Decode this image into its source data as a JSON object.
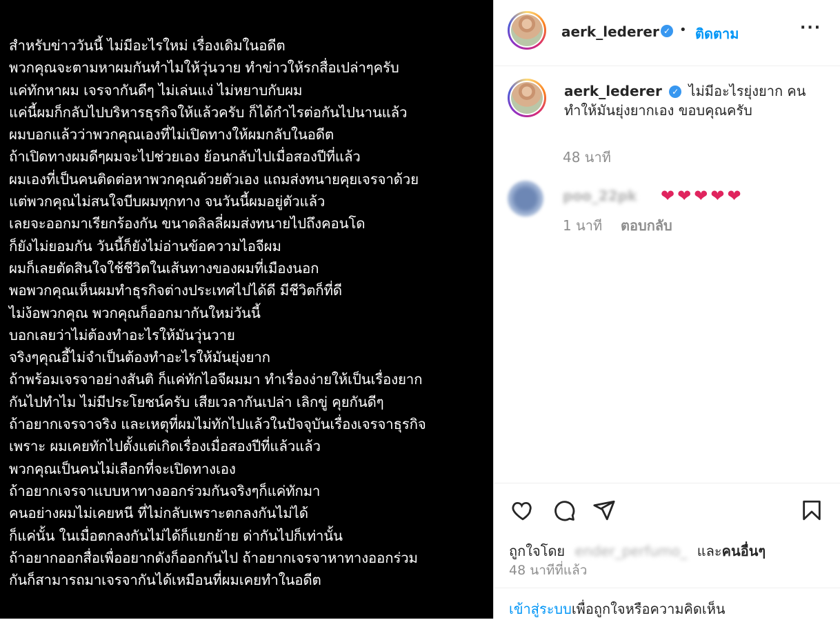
{
  "post": {
    "lines": [
      "สำหรับข่าววันนี้ ไม่มีอะไรใหม่ เรื่องเดิมในอดีต",
      "พวกคุณจะตามหาผมกันทำไมให้วุ่นวาย ทำข่าวให้รกสื่อเปล่าๆครับ",
      "แค่ทักหาผม เจรจากันดีๆ ไม่เล่นแง่ ไม่หยาบกับผม",
      "แค่นี้ผมก็กลับไปบริหารธุรกิจให้แล้วครับ ก็ได้กำไรต่อกันไปนานแล้ว",
      "ผมบอกแล้วว่าพวกคุณเองที่ไม่เปิดทางให้ผมกลับในอดีต",
      "ถ้าเปิดทางผมดีๆผมจะไปช่วยเอง ย้อนกลับไปเมื่อสองปีที่แล้ว",
      "ผมเองที่เป็นคนติดต่อหาพวกคุณด้วยตัวเอง แถมส่งทนายคุยเจรจาด้วย",
      "แต่พวกคุณไม่สนใจบีบผมทุกทาง จนวันนี้ผมอยู่ตัวแล้ว",
      "เลยจะออกมาเรียกร้องกัน ขนาดลิลลี่ผมส่งทนายไปถึงคอนโด",
      "ก็ยังไม่ยอมกัน วันนี้ก็ยังไม่อ่านข้อความไอจีผม",
      "ผมก็เลยตัดสินใจใช้ชีวิตในเส้นทางของผมที่เมืองนอก",
      "พอพวกคุณเห็นผมทำธุรกิจต่างประเทศไปได้ดี มีชีวิตก็ที่ดี",
      "ไม่ง้อพวกคุณ พวกคุณก็ออกมากันใหม่วันนี้",
      "บอกเลยว่าไม่ต้องทำอะไรให้มันวุ่นวาย",
      "จริงๆคุณอี้ไม่จำเป็นต้องทำอะไรให้มันยุ่งยาก",
      "ถ้าพร้อมเจรจาอย่างสันติ ก็แค่ทักไอจีผมมา ทำเรื่องง่ายให้เป็นเรื่องยาก",
      "กันไปทำไม ไม่มีประโยชน์ครับ เสียเวลากันเปล่า เลิกขู่ คุยกันดีๆ",
      "ถ้าอยากเจรจาจริง และเหตุที่ผมไม่ทักไปแล้วในปัจจุบันเรื่องเจรจาธุรกิจ",
      "เพราะ ผมเคยทักไปตั้งแต่เกิดเรื่องเมื่อสองปีที่แล้วแล้ว",
      "พวกคุณเป็นคนไม่เลือกที่จะเปิดทางเอง",
      "ถ้าอยากเจรจาแบบหาทางออกร่วมกันจริงๆก็แค่ทักมา",
      "คนอย่างผมไม่เคยหนี ที่ไม่กลับเพราะตกลงกันไม่ได้",
      "ก็แค่นั้น ในเมื่อตกลงกันไม่ได้ก็แยกย้าย ด่ากันไปก็เท่านั้น",
      "ถ้าอยากออกสื่อเพื่ออยากดังก็ออกกันไป ถ้าอยากเจรจาหาทางออกร่วม",
      "กันก็สามารถมาเจรจากันได้เหมือนที่ผมเคยทำในอดีต"
    ]
  },
  "header": {
    "username": "aerk_lederer",
    "separator": "•",
    "follow_label": "ติดตาม",
    "more_label": "···"
  },
  "caption": {
    "username": "aerk_lederer",
    "text": "ไม่มีอะไรยุ่งยาก คนทำให้มันยุ่งยากเอง ขอบคุณครับ",
    "time": "48 นาที"
  },
  "comment": {
    "username_blurred": "poo_22pk",
    "text": "❤❤❤❤❤",
    "time": "1 นาที",
    "reply_label": "ตอบกลับ"
  },
  "likes": {
    "prefix": "ถูกใจโดย",
    "user_blurred": "ender_perfumo_",
    "conj": "และ",
    "others": "คนอื่นๆ"
  },
  "posted_time": "48 นาทีที่แล้ว",
  "login": {
    "link": "เข้าสู่ระบบ",
    "rest": "เพื่อถูกใจหรือความคิดเห็น"
  },
  "colors": {
    "accent": "#0095f6",
    "verified": "#3897f0",
    "heart": "#e0245e"
  },
  "icons": [
    "heart-icon",
    "comment-icon",
    "share-icon",
    "bookmark-icon",
    "verified-icon",
    "more-icon"
  ]
}
